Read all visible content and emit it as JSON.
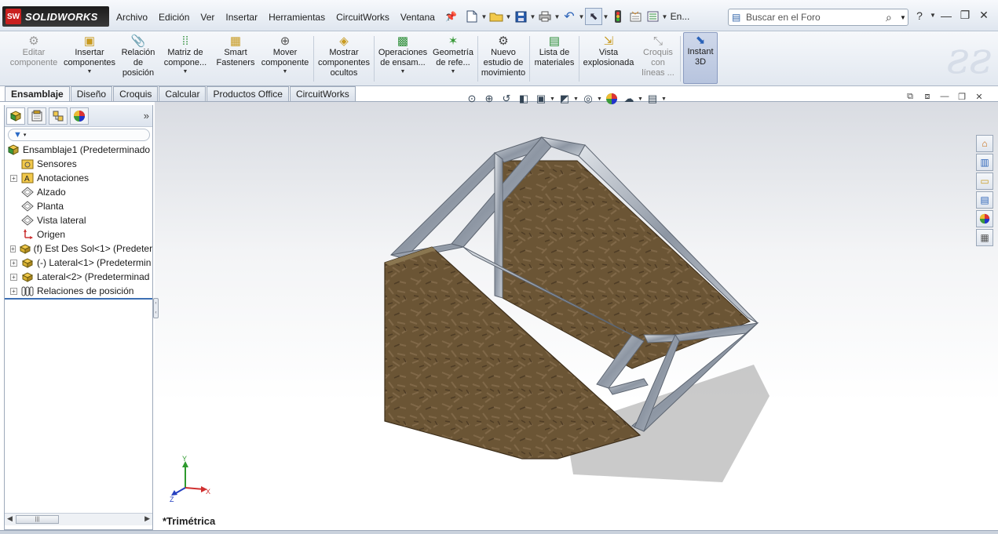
{
  "app": {
    "logo_badge": "SW",
    "logo_text": "SOLIDWORKS"
  },
  "menu": [
    "Archivo",
    "Edición",
    "Ver",
    "Insertar",
    "Herramientas",
    "CircuitWorks",
    "Ventana",
    "?"
  ],
  "quick_access": {
    "new_icon": "new-document-icon",
    "open_icon": "open-folder-icon",
    "save_icon": "save-icon",
    "print_icon": "print-icon",
    "undo_icon": "undo-icon",
    "select_icon": "select-arrow-icon",
    "rebuild_icon": "traffic-light-icon",
    "options_icon": "options-icon",
    "more_label": "En..."
  },
  "search": {
    "placeholder": "Buscar en el Foro"
  },
  "window_controls": {
    "help": "?",
    "minimize": "—",
    "restore": "❐",
    "close": "✕"
  },
  "command_manager": [
    {
      "label": "Editar\ncomponente",
      "icon": "edit-component-icon",
      "dropdown": false,
      "disabled": true,
      "active": false
    },
    {
      "label": "Insertar\ncomponentes",
      "icon": "insert-components-icon",
      "dropdown": true,
      "disabled": false,
      "active": false
    },
    {
      "label": "Relación\nde\nposición",
      "icon": "mate-icon",
      "dropdown": false,
      "disabled": false,
      "active": false
    },
    {
      "label": "Matriz de\ncompone...",
      "icon": "component-pattern-icon",
      "dropdown": true,
      "disabled": false,
      "active": false
    },
    {
      "label": "Smart\nFasteners",
      "icon": "smart-fasteners-icon",
      "dropdown": false,
      "disabled": false,
      "active": false
    },
    {
      "label": "Mover\ncomponente",
      "icon": "move-component-icon",
      "dropdown": true,
      "disabled": false,
      "active": false
    },
    {
      "label": "Mostrar\ncomponentes\nocultos",
      "icon": "show-hidden-components-icon",
      "dropdown": false,
      "disabled": false,
      "active": false
    },
    {
      "label": "Operaciones\nde ensam...",
      "icon": "assembly-features-icon",
      "dropdown": true,
      "disabled": false,
      "active": false
    },
    {
      "label": "Geometría\nde refe...",
      "icon": "reference-geometry-icon",
      "dropdown": true,
      "disabled": false,
      "active": false
    },
    {
      "label": "Nuevo\nestudio de\nmovimiento",
      "icon": "motion-study-icon",
      "dropdown": false,
      "disabled": false,
      "active": false
    },
    {
      "label": "Lista de\nmateriales",
      "icon": "bill-of-materials-icon",
      "dropdown": false,
      "disabled": false,
      "active": false
    },
    {
      "label": "Vista\nexplosionada",
      "icon": "exploded-view-icon",
      "dropdown": false,
      "disabled": false,
      "active": false
    },
    {
      "label": "Croquis\ncon\nlíneas ...",
      "icon": "explode-line-sketch-icon",
      "dropdown": false,
      "disabled": true,
      "active": false
    },
    {
      "label": "Instant\n3D",
      "icon": "instant-3d-icon",
      "dropdown": false,
      "disabled": false,
      "active": true
    }
  ],
  "tabs": [
    {
      "label": "Ensamblaje",
      "active": true
    },
    {
      "label": "Diseño",
      "active": false
    },
    {
      "label": "Croquis",
      "active": false
    },
    {
      "label": "Calcular",
      "active": false
    },
    {
      "label": "Productos Office",
      "active": false
    },
    {
      "label": "CircuitWorks",
      "active": false
    }
  ],
  "panel_tabs": [
    "feature-manager-icon",
    "property-manager-icon",
    "configuration-manager-icon",
    "display-manager-icon"
  ],
  "panel_more": "»",
  "tree": [
    {
      "label": "Ensamblaje1  (Predeterminado",
      "icon": "assembly-icon",
      "expander": "",
      "root": true
    },
    {
      "label": "Sensores",
      "icon": "sensors-folder-icon",
      "expander": "",
      "root": false
    },
    {
      "label": "Anotaciones",
      "icon": "annotations-icon",
      "expander": "+",
      "root": false
    },
    {
      "label": "Alzado",
      "icon": "plane-icon",
      "expander": "",
      "root": false
    },
    {
      "label": "Planta",
      "icon": "plane-icon",
      "expander": "",
      "root": false
    },
    {
      "label": "Vista lateral",
      "icon": "plane-icon",
      "expander": "",
      "root": false
    },
    {
      "label": "Origen",
      "icon": "origin-icon",
      "expander": "",
      "root": false
    },
    {
      "label": "(f) Est Des Sol<1> (Predeter",
      "icon": "subassembly-icon",
      "expander": "+",
      "root": false
    },
    {
      "label": "(-) Lateral<1> (Predetermin",
      "icon": "subassembly-icon",
      "expander": "+",
      "root": false
    },
    {
      "label": "Lateral<2> (Predeterminad",
      "icon": "subassembly-icon",
      "expander": "+",
      "root": false
    },
    {
      "label": "Relaciones de posición",
      "icon": "mates-folder-icon",
      "expander": "+",
      "root": false
    }
  ],
  "hud_toolbar": [
    "zoom-to-fit-icon",
    "zoom-to-area-icon",
    "previous-view-icon",
    "section-view-icon",
    "view-orientation-icon",
    "display-style-icon",
    "hide-show-icon",
    "edit-appearance-icon",
    "apply-scene-icon",
    "view-settings-icon"
  ],
  "taskpane": [
    "resources-icon",
    "design-library-icon",
    "file-explorer-icon",
    "view-palette-icon",
    "appearances-icon",
    "custom-properties-icon"
  ],
  "viewport": {
    "view_name": "*Trimétrica",
    "triad": {
      "x": "X",
      "y": "Y",
      "z": "Z"
    }
  },
  "colors": {
    "osb_board": "#6b5535",
    "frame_metal": "#9fa7b3",
    "accent_blue": "#3c6fb4"
  }
}
